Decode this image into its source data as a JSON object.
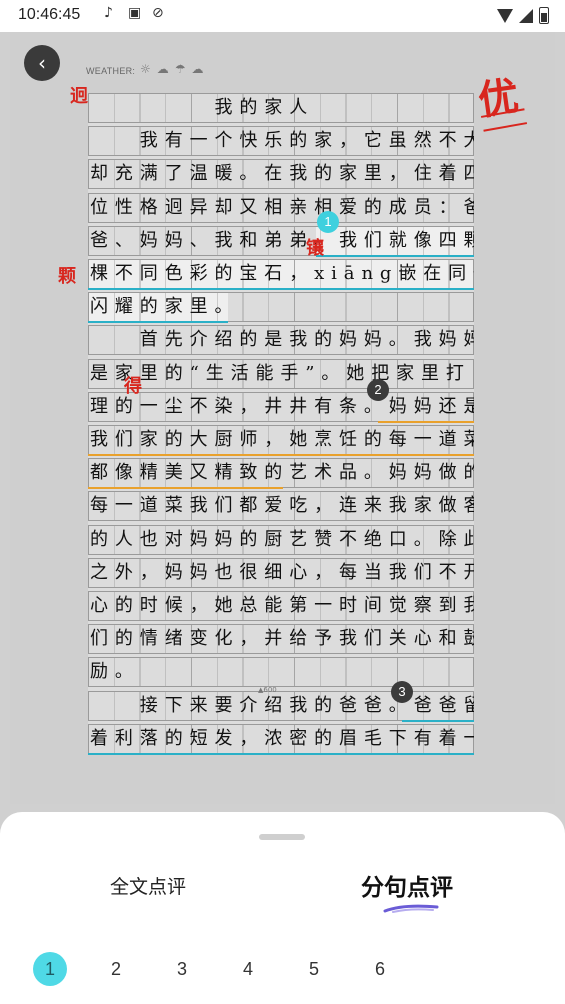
{
  "status": {
    "time": "10:46:45"
  },
  "weather_label": "WEATHER:",
  "grade": "优",
  "essay": {
    "lines": [
      "　　　　　我的家人",
      "　　我有一个快乐的家，它虽然不大，",
      "却充满了温暖。在我的家里，住着四",
      "位性格迥异却又相亲相爱的成员：爸",
      "爸、妈妈、我和弟弟。我们就像四颗",
      "棵不同色彩的宝石，xiāng嵌在同一个",
      "闪耀的家里。",
      "　　首先介绍的是我的妈妈。我妈妈",
      "是家里的“生活能手”。她把家里打",
      "理的一尘不染，井井有条。妈妈还是",
      "我们家的大厨师，她烹饪的每一道菜",
      "都像精美又精致的艺术品。妈妈做的",
      "每一道菜我们都爱吃，连来我家做客",
      "的人也对妈妈的厨艺赞不绝口。除此",
      "之外，妈妈也很细心，每当我们不开",
      "心的时候，她总能第一时间觉察到我",
      "们的情绪变化，并给予我们关心和鼓",
      "励。",
      "　　接下来要介绍我的爸爸。爸爸留",
      "着利落的短发，浓密的眉毛下有着一"
    ],
    "corrections": [
      "迥",
      "镶",
      "颗",
      "得"
    ],
    "markers": [
      "1",
      "2",
      "3"
    ],
    "page_count": "▲600"
  },
  "sheet": {
    "tab_full": "全文点评",
    "tab_sentence": "分句点评",
    "pages": [
      "1",
      "2",
      "3",
      "4",
      "5",
      "6"
    ],
    "active_page": "1"
  },
  "colors": {
    "accent": "#4fd9e6",
    "correction": "#d8261e",
    "highlight_blue": "#2ab0c7",
    "highlight_orange": "#e9a12c"
  }
}
